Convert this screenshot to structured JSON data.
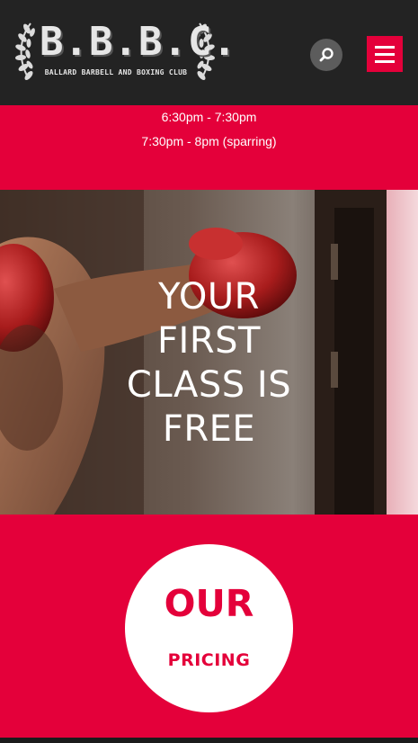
{
  "header": {
    "logo_letters": "B.B.B.C.",
    "logo_subtitle": "BALLARD BARBELL AND BOXING CLUB",
    "search_icon": "search-icon",
    "menu_icon": "hamburger-menu-icon"
  },
  "schedule": {
    "times": [
      "6:30pm - 7:30pm",
      "7:30pm - 8pm (sparring)"
    ]
  },
  "hero": {
    "lines": [
      "YOUR",
      "FIRST",
      "CLASS IS",
      "FREE"
    ]
  },
  "pricing": {
    "title": "OUR",
    "subtitle": "PRICING"
  },
  "colors": {
    "accent": "#e4003a",
    "header_bg": "#232323",
    "search_bg": "#5c5c5c",
    "text_light": "#ffffff"
  }
}
